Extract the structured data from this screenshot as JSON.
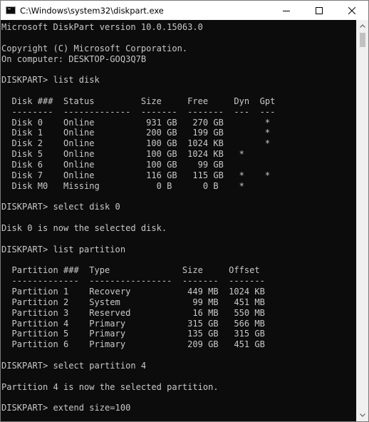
{
  "window": {
    "title": "C:\\Windows\\system32\\diskpart.exe",
    "minimize_symbol": "—",
    "maximize_symbol": "☐",
    "close_symbol": "✕"
  },
  "console": {
    "lines": [
      "Microsoft DiskPart version 10.0.15063.0",
      "",
      "Copyright (C) Microsoft Corporation.",
      "On computer: DESKTOP-GOQ3Q7B",
      "",
      "DISKPART> list disk",
      "",
      "  Disk ###  Status         Size     Free     Dyn  Gpt",
      "  --------  -------------  -------  -------  ---  ---",
      "  Disk 0    Online          931 GB   270 GB        *",
      "  Disk 1    Online          200 GB   199 GB        *",
      "  Disk 2    Online          100 GB  1024 KB        *",
      "  Disk 5    Online          100 GB  1024 KB   *",
      "  Disk 6    Online          100 GB    99 GB",
      "  Disk 7    Online          116 GB   115 GB   *    *",
      "  Disk M0   Missing           0 B      0 B    *",
      "",
      "DISKPART> select disk 0",
      "",
      "Disk 0 is now the selected disk.",
      "",
      "DISKPART> list partition",
      "",
      "  Partition ###  Type              Size     Offset",
      "  -------------  ----------------  -------  -------",
      "  Partition 1    Recovery           449 MB  1024 KB",
      "  Partition 2    System              99 MB   451 MB",
      "  Partition 3    Reserved            16 MB   550 MB",
      "  Partition 4    Primary            315 GB   566 MB",
      "  Partition 5    Primary            135 GB   315 GB",
      "  Partition 6    Primary            209 GB   451 GB",
      "",
      "DISKPART> select partition 4",
      "",
      "Partition 4 is now the selected partition.",
      "",
      "DISKPART> extend size=100"
    ]
  },
  "colors": {
    "console_background": "#0c0c0c",
    "console_text": "#c8c8c8",
    "titlebar_background": "#ffffff"
  }
}
